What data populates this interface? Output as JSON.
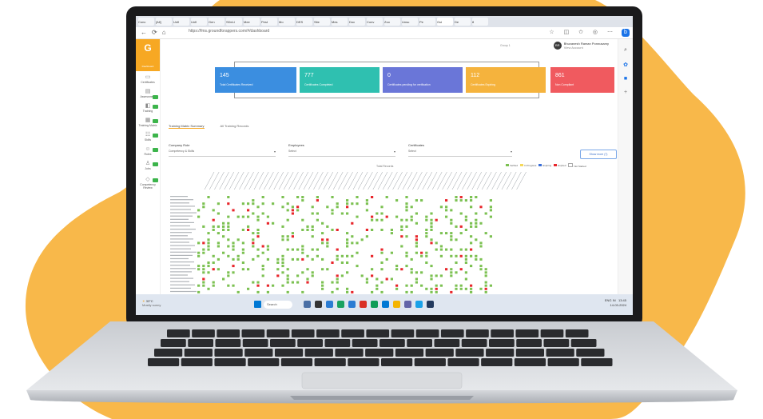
{
  "colors": {
    "accent": "#f7a823",
    "card_blue": "#3b8ee0",
    "card_teal": "#2fc0b0",
    "card_purple": "#6a76d8",
    "card_orange": "#f5b33d",
    "card_red": "#f05a5f",
    "cell_green": "#7cc152",
    "cell_red": "#e8262b"
  },
  "browser": {
    "tabs": [
      "Conc",
      "[All]",
      "Unfi",
      "Unfi",
      "Gen",
      "SDeLi",
      "Mee",
      "Pest",
      "Mo",
      "DES",
      "Site",
      "Mes",
      "Doc",
      "Conv",
      "Zoo",
      "Unsu",
      "Pe",
      "Gui",
      "De",
      "8"
    ],
    "url": "https://fms.groundforappers.com/#/dashboard"
  },
  "app": {
    "logo": "G",
    "logo_label": "Dashboard",
    "sidebar": [
      "Dashboard",
      "Certificates",
      "Assessment",
      "Training",
      "Training Matrix",
      "Skills",
      "Roles",
      "Jobs",
      "Competency Review"
    ],
    "user_name": "Bhuvanesh Raman Ponnusamy",
    "user_sub": "View Account",
    "user_initials": "BR",
    "org": "Group 1",
    "cards": [
      {
        "value": "145",
        "label": "Total Certificates Received"
      },
      {
        "value": "777",
        "label": "Certificates Completed"
      },
      {
        "value": "0",
        "label": "Certificates pending for verification"
      },
      {
        "value": "112",
        "label": "Certificates Expiring"
      },
      {
        "value": "861",
        "label": "Non Compliant"
      }
    ],
    "subtabs": [
      "Training Matrix Summary",
      "All Training Records"
    ],
    "filters": {
      "company": {
        "label": "Company Role",
        "value": "Competency & Skills"
      },
      "employee": {
        "label": "Employees",
        "value": "Select"
      },
      "certificate": {
        "label": "Certificates",
        "value": "Select"
      },
      "button": "Show more (7)"
    },
    "total": "Total Records",
    "legend": [
      "Verified",
      "In Progress",
      "Expiring",
      "Expired",
      "Not Started"
    ]
  },
  "taskbar": {
    "weather": "33°C",
    "weather_sub": "Mostly sunny",
    "search": "Search",
    "time": "13:45",
    "date": "14-03-2024",
    "lang": "ENG IN"
  }
}
